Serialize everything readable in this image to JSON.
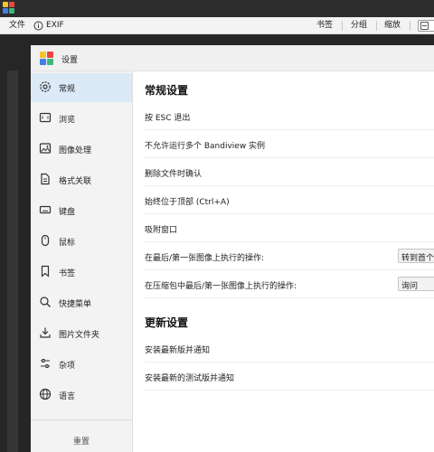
{
  "menubar": {
    "file": "文件",
    "exif": "EXIF",
    "bookmarks": "书签",
    "group": "分组",
    "zoom": "缩放"
  },
  "dialog": {
    "title": "设置"
  },
  "sidebar": {
    "items": [
      {
        "label": "常规",
        "icon": "gear-icon",
        "active": true
      },
      {
        "label": "浏览",
        "icon": "frame-icon",
        "active": false
      },
      {
        "label": "图像处理",
        "icon": "image-icon",
        "active": false
      },
      {
        "label": "格式关联",
        "icon": "document-icon",
        "active": false
      },
      {
        "label": "键盘",
        "icon": "keyboard-icon",
        "active": false
      },
      {
        "label": "鼠标",
        "icon": "mouse-icon",
        "active": false
      },
      {
        "label": "书签",
        "icon": "bookmark-icon",
        "active": false
      },
      {
        "label": "快捷菜单",
        "icon": "search-icon",
        "active": false
      },
      {
        "label": "图片文件夹",
        "icon": "download-icon",
        "active": false
      },
      {
        "label": "杂项",
        "icon": "sliders-icon",
        "active": false
      },
      {
        "label": "语言",
        "icon": "globe-icon",
        "active": false
      }
    ],
    "reset": "重置"
  },
  "general": {
    "title": "常规设置",
    "rows": [
      {
        "label": "按 ESC 退出"
      },
      {
        "label": "不允许运行多个 Bandiview 实例"
      },
      {
        "label": "删除文件时确认"
      },
      {
        "label": "始终位于顶部 (Ctrl+A)"
      },
      {
        "label": "吸附窗口"
      },
      {
        "label": "在最后/第一张图像上执行的操作:",
        "select": "转到首个文"
      },
      {
        "label": "在压缩包中最后/第一张图像上执行的操作:",
        "select": "询问"
      }
    ]
  },
  "update": {
    "title": "更新设置",
    "rows": [
      {
        "label": "安装最新版并通知"
      },
      {
        "label": "安装最新的测试版并通知"
      }
    ]
  },
  "colors": {
    "accent": "#dce9f6",
    "logo_yellow": "#f5c32c",
    "logo_red": "#e8473c",
    "logo_blue": "#3f7fe6",
    "logo_green": "#3cb878"
  }
}
